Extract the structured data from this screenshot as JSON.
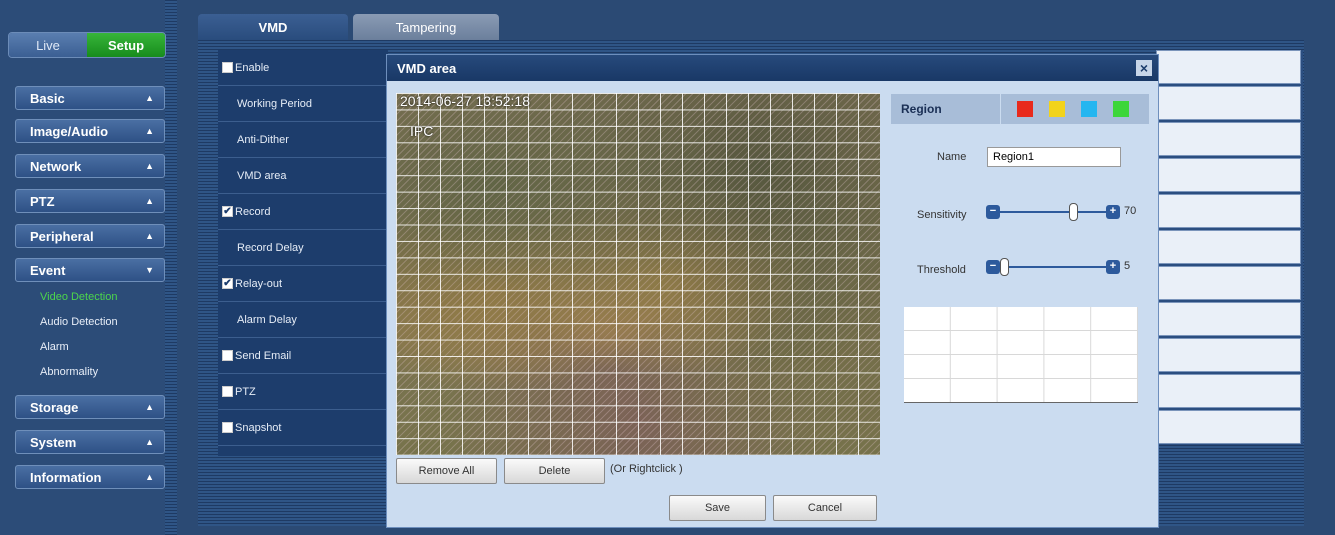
{
  "mode_tabs": {
    "live": "Live",
    "setup": "Setup"
  },
  "nav": {
    "items": [
      "Basic",
      "Image/Audio",
      "Network",
      "PTZ",
      "Peripheral",
      "Event",
      "Storage",
      "System",
      "Information"
    ],
    "event_sub": [
      "Video Detection",
      "Audio Detection",
      "Alarm",
      "Abnormality"
    ],
    "active_sub": "Video Detection"
  },
  "tabs": {
    "vmd": "VMD",
    "tampering": "Tampering"
  },
  "settings": {
    "enable": "Enable",
    "working_period": "Working Period",
    "anti_dither": "Anti-Dither",
    "vmd_area": "VMD area",
    "record": "Record",
    "record_delay": "Record Delay",
    "relay_out": "Relay-out",
    "alarm_delay": "Alarm Delay",
    "send_email": "Send Email",
    "ptz": "PTZ",
    "snapshot": "Snapshot",
    "check_mark": "✔",
    "checked": {
      "enable": false,
      "record": true,
      "relay_out": true,
      "send_email": false,
      "ptz": false,
      "snapshot": false
    }
  },
  "modal": {
    "title": "VMD area",
    "close": "×",
    "osd_timestamp": "2014-06-27 13:52:18",
    "osd_channel": "IPC",
    "remove_all": "Remove All",
    "delete": "Delete",
    "hint": "(Or Rightclick )",
    "save": "Save",
    "cancel": "Cancel"
  },
  "region": {
    "label": "Region",
    "swatch_colors": [
      "#e8291c",
      "#f2d31b",
      "#25b6f0",
      "#3dd63a"
    ],
    "name_label": "Name",
    "name_value": "Region1",
    "sensitivity_label": "Sensitivity",
    "sensitivity_value": "70",
    "sensitivity_level": 70,
    "threshold_label": "Threshold",
    "threshold_value": "5",
    "threshold_level": 5,
    "minus": "−",
    "plus": "+"
  }
}
